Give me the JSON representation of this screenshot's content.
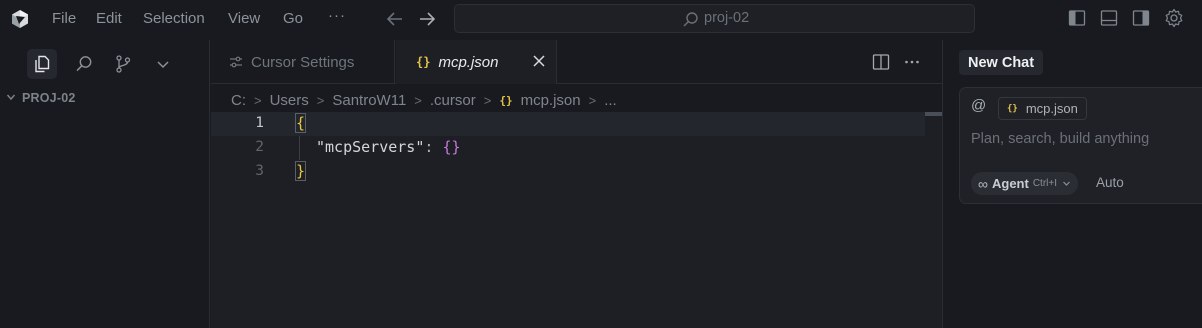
{
  "menu": {
    "items": [
      "File",
      "Edit",
      "Selection",
      "View",
      "Go"
    ],
    "more": "···"
  },
  "search": {
    "text": "proj-02"
  },
  "sidebar": {
    "project_title": "PROJ-02"
  },
  "tabs": [
    {
      "label": "Cursor Settings",
      "active": false
    },
    {
      "label": "mcp.json",
      "active": true,
      "icon": "{}"
    }
  ],
  "breadcrumb": {
    "parts": [
      "C:",
      "Users",
      "SantroW11",
      ".cursor",
      "mcp.json",
      "..."
    ],
    "file_icon": "{}",
    "separator": ">"
  },
  "editor": {
    "line_numbers": [
      "1",
      "2",
      "3"
    ],
    "line1_open": "{",
    "line2_key": "\"mcpServers\"",
    "line2_colon": ": ",
    "line2_value": "{}",
    "line3_close": "}"
  },
  "chat": {
    "tab_label": "New Chat",
    "at_symbol": "@",
    "context_chip": "mcp.json",
    "context_chip_icon": "{}",
    "placeholder": "Plan, search, build anything",
    "mode_icon": "∞",
    "mode_label": "Agent",
    "mode_shortcut": "Ctrl+I",
    "model_label": "Auto"
  },
  "colors": {
    "accent_json": "#e3c24b",
    "bracket_purple": "#c678dd",
    "background": "#181a1f",
    "editor_bg": "#1d1f24"
  }
}
